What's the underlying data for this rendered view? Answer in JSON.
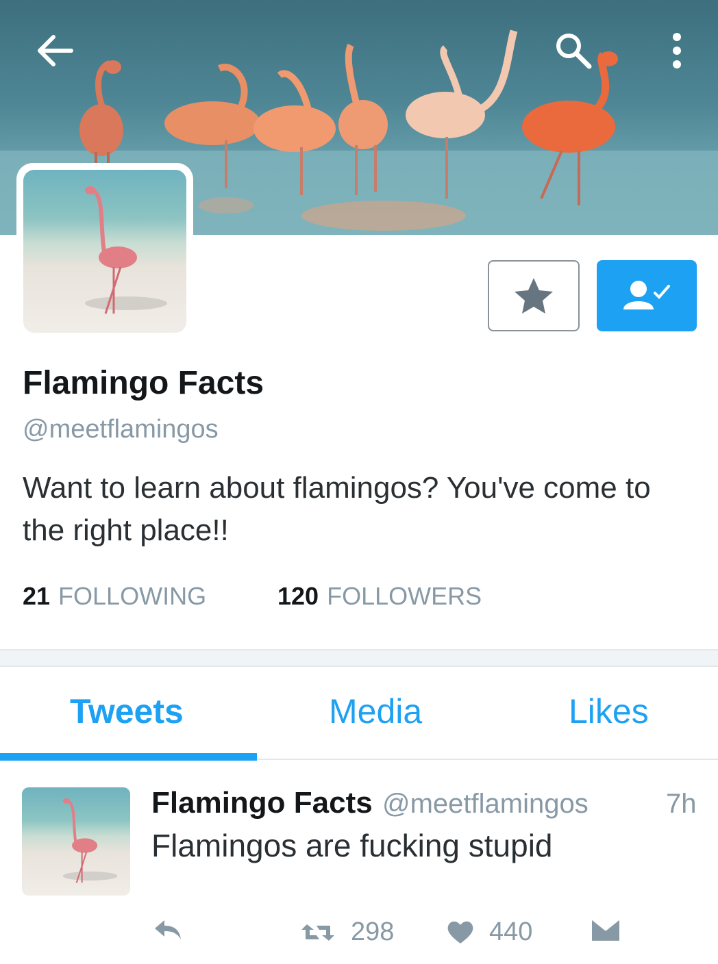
{
  "header": {
    "icons": [
      "back-arrow-icon",
      "search-icon",
      "more-vertical-icon"
    ]
  },
  "profile": {
    "display_name": "Flamingo Facts",
    "handle": "@meetflamingos",
    "bio": "Want to learn about flamingos? You've come to the right place!!",
    "stats": {
      "following_count": "21",
      "following_label": "FOLLOWING",
      "followers_count": "120",
      "followers_label": "FOLLOWERS"
    },
    "buttons": {
      "favorite_icon": "star-icon",
      "follow_icon": "person-check-icon"
    }
  },
  "tabs": [
    {
      "label": "Tweets",
      "active": true
    },
    {
      "label": "Media",
      "active": false
    },
    {
      "label": "Likes",
      "active": false
    }
  ],
  "tweet": {
    "author_name": "Flamingo Facts",
    "author_handle": "@meetflamingos",
    "time": "7h",
    "text": "Flamingos are fucking stupid",
    "retweets": "298",
    "likes": "440"
  },
  "colors": {
    "accent": "#1da1f2",
    "muted_text": "#8899a6",
    "primary_text": "#14171a"
  }
}
